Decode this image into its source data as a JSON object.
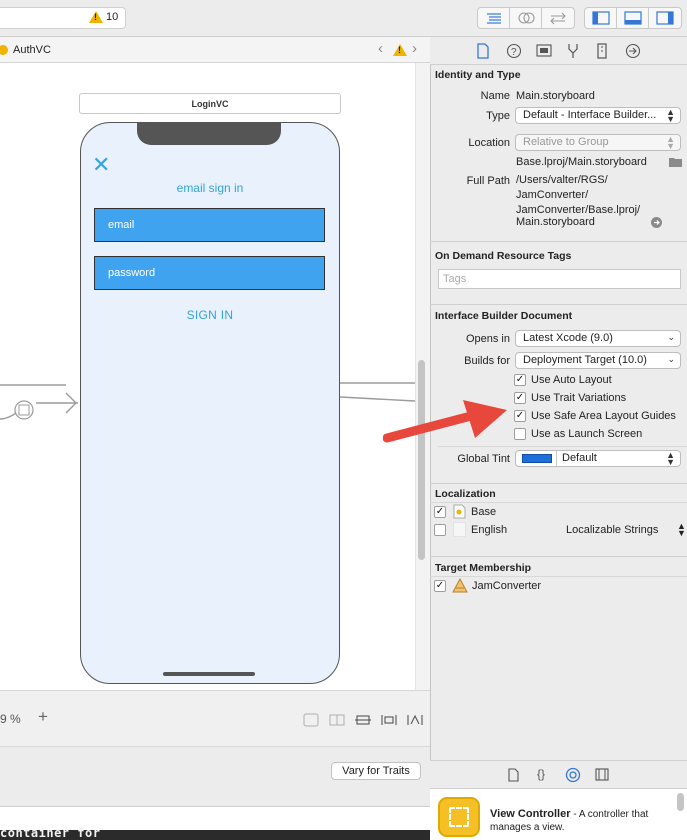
{
  "toolbar": {
    "warning_count": "10"
  },
  "jumpbar": {
    "file": "AuthVC"
  },
  "scene": {
    "title": "LoginVC",
    "heading": "email sign in",
    "email_placeholder": "email",
    "password_placeholder": "password",
    "sign_in_button": "SIGN IN",
    "close_glyph": "✕"
  },
  "canvas_footer": {
    "zoom": "9 %",
    "vary_for_traits": "Vary for Traits"
  },
  "console": {
    "text": "container for"
  },
  "inspector": {
    "identity": {
      "section": "Identity and Type",
      "name_label": "Name",
      "name_value": "Main.storyboard",
      "type_label": "Type",
      "type_value": "Default - Interface Builder...",
      "location_label": "Location",
      "location_value": "Relative to Group",
      "location_path": "Base.lproj/Main.storyboard",
      "fullpath_label": "Full Path",
      "fullpath_lines": [
        "/Users/valter/RGS/",
        "JamConverter/",
        "JamConverter/Base.lproj/",
        "Main.storyboard"
      ]
    },
    "tags": {
      "section": "On Demand Resource Tags",
      "placeholder": "Tags"
    },
    "ib_document": {
      "section": "Interface Builder Document",
      "opens_in_label": "Opens in",
      "opens_in_value": "Latest Xcode (9.0)",
      "builds_for_label": "Builds for",
      "builds_for_value": "Deployment Target (10.0)",
      "checkboxes": [
        {
          "label": "Use Auto Layout",
          "checked": true
        },
        {
          "label": "Use Trait Variations",
          "checked": true
        },
        {
          "label": "Use Safe Area Layout Guides",
          "checked": true
        },
        {
          "label": "Use as Launch Screen",
          "checked": false
        }
      ],
      "global_tint_label": "Global Tint",
      "global_tint_value": "Default",
      "tint_color": "#1f6fd9"
    },
    "localization": {
      "section": "Localization",
      "rows": [
        {
          "label": "Base",
          "checked": true,
          "extra": ""
        },
        {
          "label": "English",
          "checked": false,
          "extra": "Localizable Strings"
        }
      ]
    },
    "target": {
      "section": "Target Membership",
      "rows": [
        {
          "label": "JamConverter",
          "checked": true
        }
      ]
    }
  },
  "library": {
    "item_title": "View Controller",
    "item_desc_1": " - A controller that",
    "item_desc_2": "manages a view."
  },
  "colors": {
    "accent": "#34a4dc",
    "field": "#3fa3f0",
    "warning": "#f0b400",
    "arrow": "#e8473b"
  }
}
